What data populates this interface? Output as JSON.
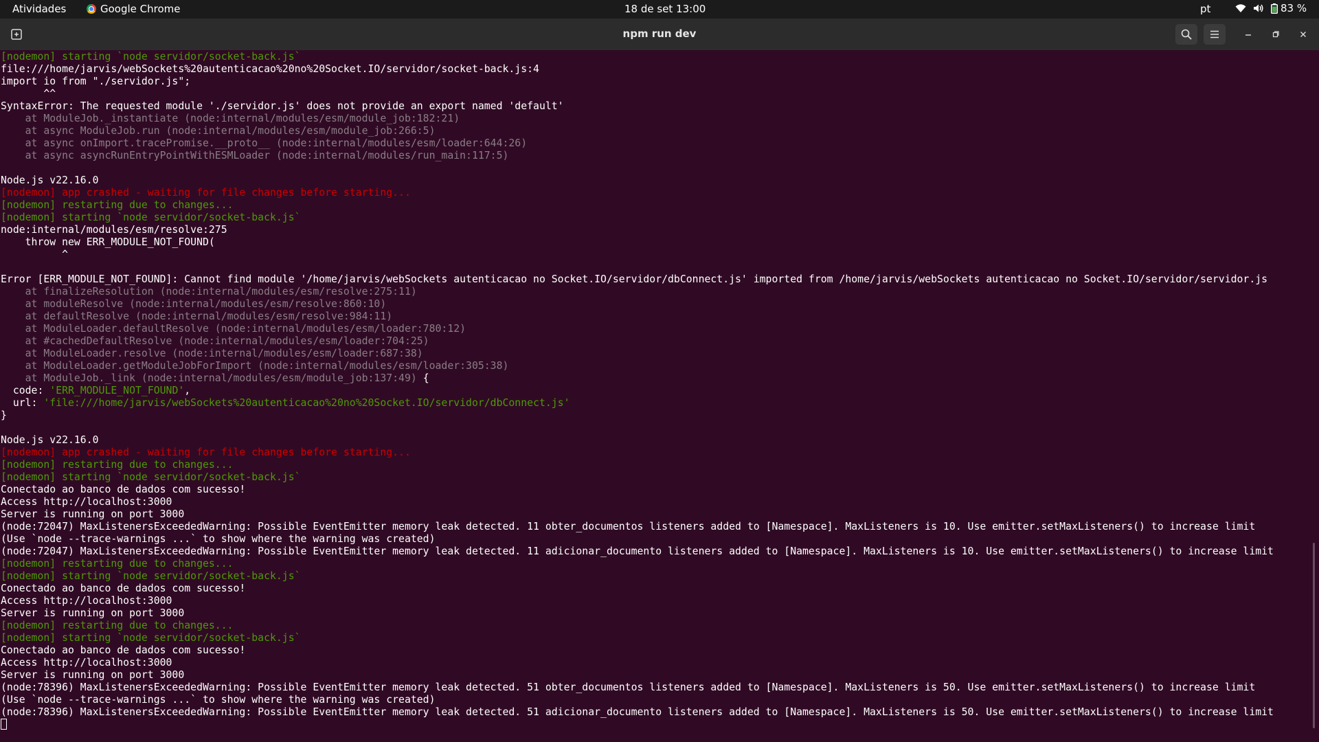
{
  "topbar": {
    "activities": "Atividades",
    "app_name": "Google Chrome",
    "clock": "18 de set  13:00",
    "lang": "pt",
    "battery": "83 %",
    "icons": [
      "wifi-icon",
      "volume-icon",
      "battery-icon"
    ]
  },
  "window": {
    "title": "npm run dev",
    "buttons": [
      "new-tab-icon",
      "search-icon",
      "menu-icon",
      "minimize-icon",
      "maximize-icon",
      "close-icon"
    ]
  },
  "colors": {
    "background": "#300a24",
    "nodemon_green": "#4e9a06",
    "crash_red": "#cc0000",
    "stack_dim": "#8a7d86"
  },
  "terminal": {
    "lines": [
      {
        "t": "[nodemon] starting `node servidor/socket-back.js`",
        "c": "green"
      },
      {
        "t": "file:///home/jarvis/webSockets%20autenticacao%20no%20Socket.IO/servidor/socket-back.js:4",
        "c": ""
      },
      {
        "t": "import io from \"./servidor.js\";",
        "c": ""
      },
      {
        "t": "       ^^",
        "c": ""
      },
      {
        "t": "SyntaxError: The requested module './servidor.js' does not provide an export named 'default'",
        "c": ""
      },
      {
        "t": "    at ModuleJob._instantiate (node:internal/modules/esm/module_job:182:21)",
        "c": "dim"
      },
      {
        "t": "    at async ModuleJob.run (node:internal/modules/esm/module_job:266:5)",
        "c": "dim"
      },
      {
        "t": "    at async onImport.tracePromise.__proto__ (node:internal/modules/esm/loader:644:26)",
        "c": "dim"
      },
      {
        "t": "    at async asyncRunEntryPointWithESMLoader (node:internal/modules/run_main:117:5)",
        "c": "dim"
      },
      {
        "t": "",
        "c": ""
      },
      {
        "t": "Node.js v22.16.0",
        "c": ""
      },
      {
        "t": "[nodemon] app crashed - waiting for file changes before starting...",
        "c": "red"
      },
      {
        "t": "[nodemon] restarting due to changes...",
        "c": "green"
      },
      {
        "t": "[nodemon] starting `node servidor/socket-back.js`",
        "c": "green"
      },
      {
        "t": "node:internal/modules/esm/resolve:275",
        "c": ""
      },
      {
        "t": "    throw new ERR_MODULE_NOT_FOUND(",
        "c": ""
      },
      {
        "t": "          ^",
        "c": ""
      },
      {
        "t": "",
        "c": ""
      },
      {
        "t": "Error [ERR_MODULE_NOT_FOUND]: Cannot find module '/home/jarvis/webSockets autenticacao no Socket.IO/servidor/dbConnect.js' imported from /home/jarvis/webSockets autenticacao no Socket.IO/servidor/servidor.js",
        "c": ""
      },
      {
        "t": "    at finalizeResolution (node:internal/modules/esm/resolve:275:11)",
        "c": "dim"
      },
      {
        "t": "    at moduleResolve (node:internal/modules/esm/resolve:860:10)",
        "c": "dim"
      },
      {
        "t": "    at defaultResolve (node:internal/modules/esm/resolve:984:11)",
        "c": "dim"
      },
      {
        "t": "    at ModuleLoader.defaultResolve (node:internal/modules/esm/loader:780:12)",
        "c": "dim"
      },
      {
        "t": "    at #cachedDefaultResolve (node:internal/modules/esm/loader:704:25)",
        "c": "dim"
      },
      {
        "t": "    at ModuleLoader.resolve (node:internal/modules/esm/loader:687:38)",
        "c": "dim"
      },
      {
        "t": "    at ModuleLoader.getModuleJobForImport (node:internal/modules/esm/loader:305:38)",
        "c": "dim"
      },
      {
        "t": "    at ModuleJob._link (node:internal/modules/esm/module_job:137:49)",
        "c": "dim",
        "suffix": " {"
      },
      {
        "t": "  code: ",
        "c": "",
        "str": "'ERR_MODULE_NOT_FOUND'",
        "suffix": ","
      },
      {
        "t": "  url: ",
        "c": "",
        "str": "'file:///home/jarvis/webSockets%20autenticacao%20no%20Socket.IO/servidor/dbConnect.js'"
      },
      {
        "t": "}",
        "c": ""
      },
      {
        "t": "",
        "c": ""
      },
      {
        "t": "Node.js v22.16.0",
        "c": ""
      },
      {
        "t": "[nodemon] app crashed - waiting for file changes before starting...",
        "c": "red"
      },
      {
        "t": "[nodemon] restarting due to changes...",
        "c": "green"
      },
      {
        "t": "[nodemon] starting `node servidor/socket-back.js`",
        "c": "green"
      },
      {
        "t": "Conectado ao banco de dados com sucesso!",
        "c": ""
      },
      {
        "t": "Access http://localhost:3000",
        "c": ""
      },
      {
        "t": "Server is running on port 3000",
        "c": ""
      },
      {
        "t": "(node:72047) MaxListenersExceededWarning: Possible EventEmitter memory leak detected. 11 obter_documentos listeners added to [Namespace]. MaxListeners is 10. Use emitter.setMaxListeners() to increase limit",
        "c": ""
      },
      {
        "t": "(Use `node --trace-warnings ...` to show where the warning was created)",
        "c": ""
      },
      {
        "t": "(node:72047) MaxListenersExceededWarning: Possible EventEmitter memory leak detected. 11 adicionar_documento listeners added to [Namespace]. MaxListeners is 10. Use emitter.setMaxListeners() to increase limit",
        "c": ""
      },
      {
        "t": "[nodemon] restarting due to changes...",
        "c": "green"
      },
      {
        "t": "[nodemon] starting `node servidor/socket-back.js`",
        "c": "green"
      },
      {
        "t": "Conectado ao banco de dados com sucesso!",
        "c": ""
      },
      {
        "t": "Access http://localhost:3000",
        "c": ""
      },
      {
        "t": "Server is running on port 3000",
        "c": ""
      },
      {
        "t": "[nodemon] restarting due to changes...",
        "c": "green"
      },
      {
        "t": "[nodemon] starting `node servidor/socket-back.js`",
        "c": "green"
      },
      {
        "t": "Conectado ao banco de dados com sucesso!",
        "c": ""
      },
      {
        "t": "Access http://localhost:3000",
        "c": ""
      },
      {
        "t": "Server is running on port 3000",
        "c": ""
      },
      {
        "t": "(node:78396) MaxListenersExceededWarning: Possible EventEmitter memory leak detected. 51 obter_documentos listeners added to [Namespace]. MaxListeners is 50. Use emitter.setMaxListeners() to increase limit",
        "c": ""
      },
      {
        "t": "(Use `node --trace-warnings ...` to show where the warning was created)",
        "c": ""
      },
      {
        "t": "(node:78396) MaxListenersExceededWarning: Possible EventEmitter memory leak detected. 51 adicionar_documento listeners added to [Namespace]. MaxListeners is 50. Use emitter.setMaxListeners() to increase limit",
        "c": ""
      }
    ]
  }
}
